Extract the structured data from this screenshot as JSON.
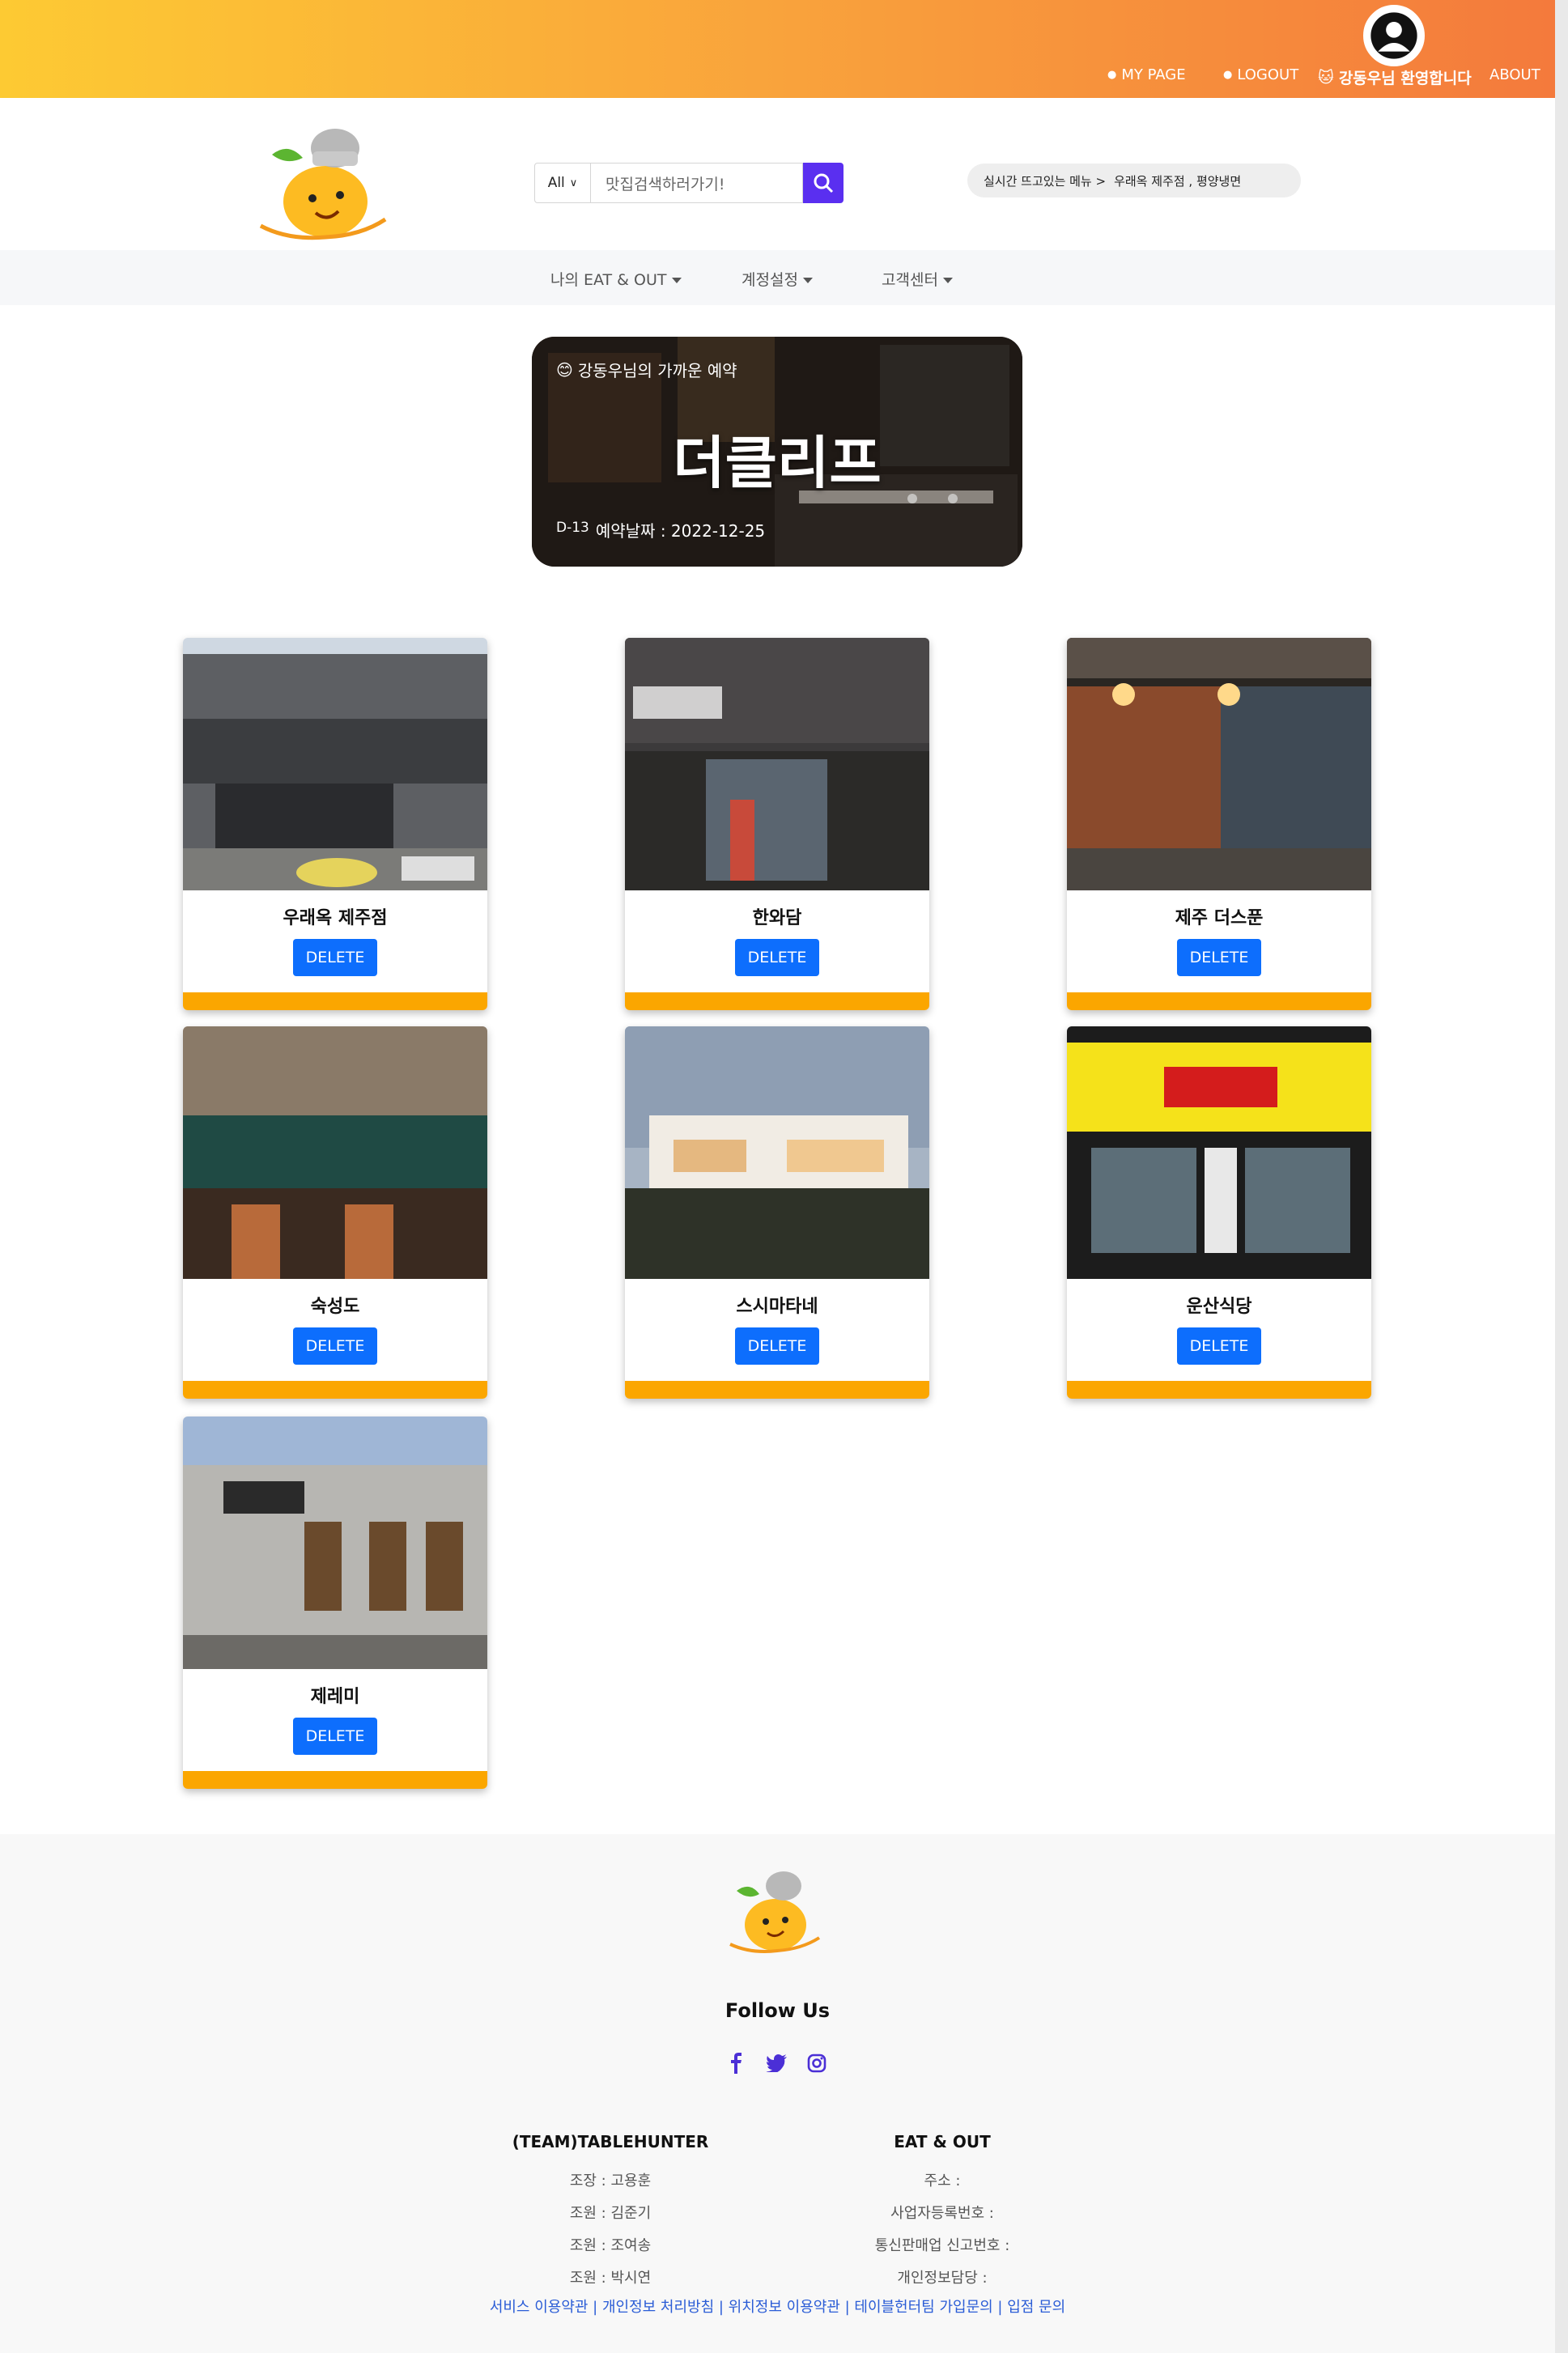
{
  "topbar": {
    "my_page": "MY PAGE",
    "logout": "LOGOUT",
    "welcome": "강동우님 환영합니다",
    "about": "ABOUT"
  },
  "header": {
    "search": {
      "category": "All",
      "placeholder": "맛집검색하러가기!"
    },
    "realtime": {
      "label": "실시간 뜨고있는 메뉴 >",
      "value": "우래옥 제주점 , 평양냉면"
    }
  },
  "subnav": {
    "items": [
      {
        "label": "나의 EAT & OUT"
      },
      {
        "label": "계정설정"
      },
      {
        "label": "고객센터"
      }
    ]
  },
  "banner": {
    "subtitle": "강동우님의 가까운 예약",
    "title": "더클리프",
    "dday": "D-13",
    "date": "예약날짜 : 2022-12-25"
  },
  "cards": [
    {
      "name": "우래옥 제주점",
      "button": "DELETE"
    },
    {
      "name": "한와담",
      "button": "DELETE"
    },
    {
      "name": "제주 더스푼",
      "button": "DELETE"
    },
    {
      "name": "숙성도",
      "button": "DELETE"
    },
    {
      "name": "스시마타네",
      "button": "DELETE"
    },
    {
      "name": "운산식당",
      "button": "DELETE"
    },
    {
      "name": "제레미",
      "button": "DELETE"
    }
  ],
  "footer": {
    "follow": "Follow Us",
    "team": {
      "title": "(TEAM)TABLEHUNTER",
      "lines": [
        "조장 : 고용훈",
        "조원 : 김준기",
        "조원 : 조여송",
        "조원 : 박시연"
      ]
    },
    "company": {
      "title": "EAT & OUT",
      "lines": [
        "주소 :",
        "사업자등록번호 :",
        "통신판매업 신고번호 :",
        "개인정보담당 :"
      ]
    },
    "links": "서비스 이용약관 | 개인정보 처리방침 | 위치정보 이용약관 | 테이블헌터팀 가입문의 | 입점 문의"
  },
  "colors": {
    "accent": "#5a2ff0",
    "delete_button": "#0d6efd",
    "card_bar": "#fba600",
    "topbar_start": "#fdca33",
    "topbar_end": "#f47a3c"
  }
}
